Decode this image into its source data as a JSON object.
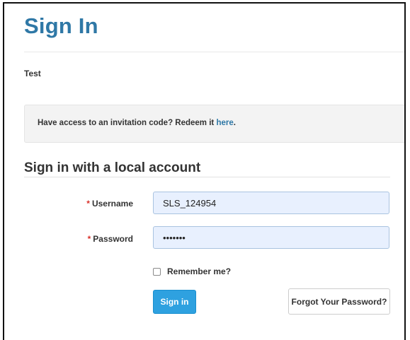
{
  "header": {
    "title": "Sign In",
    "subtitle": "Test"
  },
  "invitation": {
    "text": "Have access to an invitation code? Redeem it ",
    "link_label": "here",
    "suffix": "."
  },
  "local_account": {
    "heading": "Sign in with a local account",
    "required_marker": "*",
    "username_label": "Username",
    "username_value": "SLS_124954",
    "password_label": "Password",
    "password_value": "1234567",
    "remember_label": "Remember me?",
    "remember_checked": false,
    "sign_in_label": "Sign in",
    "forgot_label": "Forgot Your Password?"
  },
  "colors": {
    "title": "#2f78a6",
    "link": "#2f78a6",
    "primary_button": "#2ea1e0",
    "required": "#d9322b",
    "autofill_input": "#e8f0fe"
  }
}
